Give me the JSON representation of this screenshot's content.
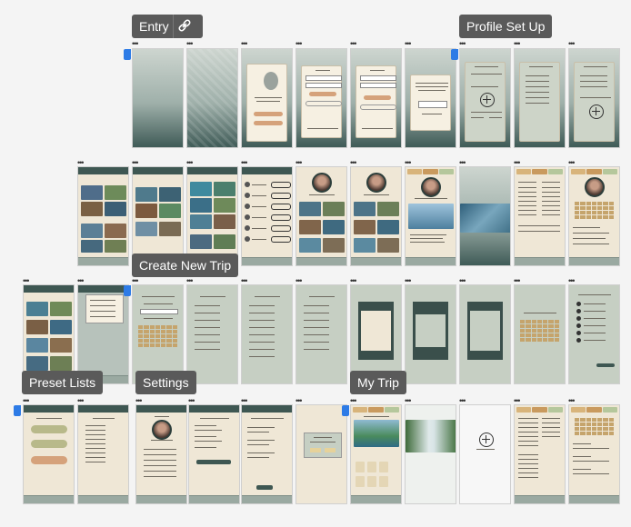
{
  "sections": {
    "entry": "Entry",
    "profile_set_up": "Profile Set Up",
    "create_new_trip": "Create New Trip",
    "preset_lists": "Preset Lists",
    "settings": "Settings",
    "my_trip": "My Trip"
  },
  "icons": {
    "link": "link-icon",
    "frame_menu": "more-dots-icon",
    "add": "plus-circle-icon",
    "avatar": "avatar-icon"
  },
  "colors": {
    "tag_bg": "#5a5a5a",
    "frame_highlight": "#2d7be6",
    "dark_green": "#3e5752",
    "cream": "#efe7d6",
    "sage": "#c6cfc3",
    "accent_tan": "#d5a27b"
  }
}
